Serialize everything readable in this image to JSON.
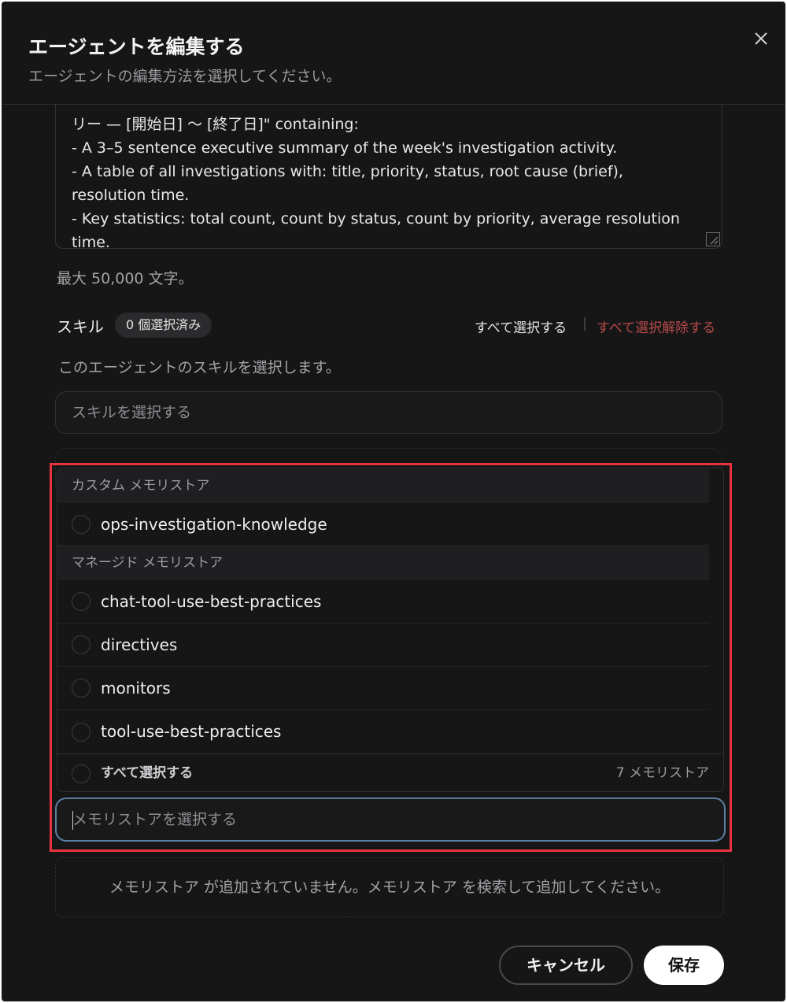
{
  "dialog": {
    "title": "エージェントを編集する",
    "subtitle": "エージェントの編集方法を選択してください。"
  },
  "prompt": {
    "text": "リー — [開始日] 〜 [終了日]\" containing:\n- A 3–5 sentence executive summary of the week's investigation activity.\n- A table of all investigations with: title, priority, status, root cause (brief), resolution time.\n- Key statistics: total count, count by status, count by priority, average resolution time.",
    "char_limit": "最大 50,000 文字。"
  },
  "skills": {
    "label": "スキル",
    "selected_badge": "0 個選択済み",
    "select_all": "すべて選択する",
    "separator": "|",
    "deselect_all": "すべて選択解除する",
    "description": "このエージェントのスキルを選択します。",
    "placeholder": "スキルを選択する"
  },
  "memory_dropdown": {
    "groups": [
      {
        "header": "カスタム メモリストア",
        "items": [
          "ops-investigation-knowledge"
        ]
      },
      {
        "header": "マネージド メモリストア",
        "items": [
          "chat-tool-use-best-practices",
          "directives",
          "monitors",
          "tool-use-best-practices"
        ]
      }
    ],
    "footer": {
      "select_all": "すべて選択する",
      "count": "7 メモリストア"
    },
    "input_placeholder": "メモリストアを選択する"
  },
  "memory_empty": "メモリストア が追加されていません。メモリストア を検索して追加してください。",
  "actions": {
    "cancel": "キャンセル",
    "save": "保存"
  },
  "colors": {
    "background": "#161617",
    "highlight": "#e8323f",
    "deselect_link": "#b94a4a",
    "input_focus": "#5b7fa3"
  }
}
